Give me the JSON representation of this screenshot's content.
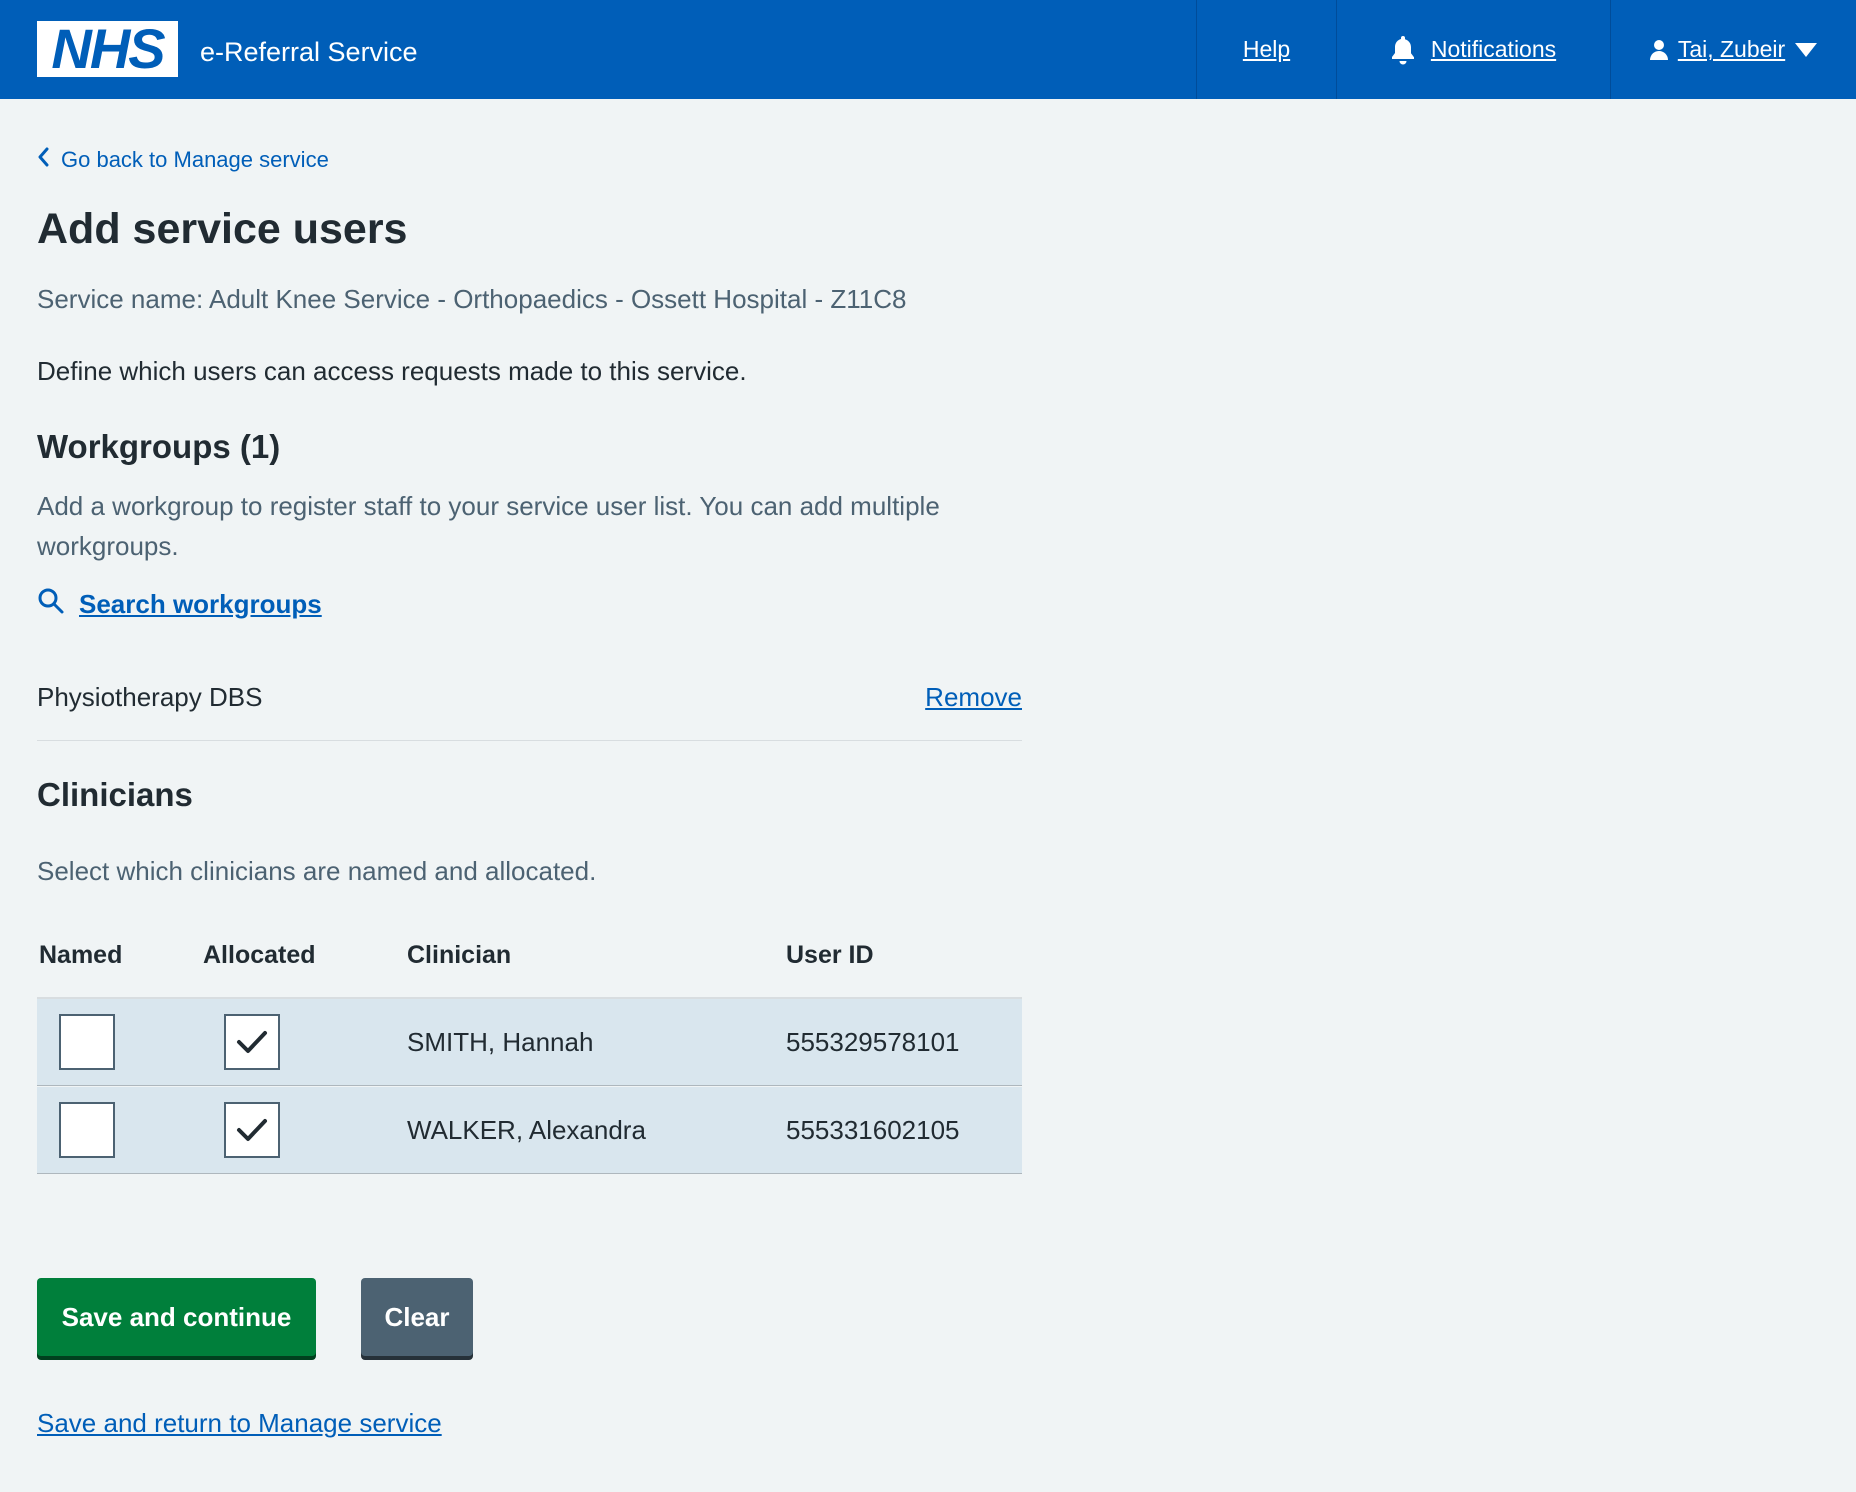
{
  "header": {
    "logo_text": "NHS",
    "service_name": "e-Referral Service",
    "nav": {
      "help": "Help",
      "notifications": "Notifications",
      "user": "Tai, Zubeir"
    }
  },
  "back_link": "Go back to Manage service",
  "page_title": "Add service users",
  "service_line": "Service name: Adult Knee Service - Orthopaedics - Ossett Hospital - Z11C8",
  "intro": "Define which users can access requests made to this service.",
  "workgroups": {
    "heading": "Workgroups (1)",
    "description": "Add a workgroup to register staff to your service user list. You can add multiple workgroups.",
    "search_link": "Search workgroups",
    "items": [
      {
        "name": "Physiotherapy DBS",
        "remove_label": "Remove"
      }
    ]
  },
  "clinicians": {
    "heading": "Clinicians",
    "description": "Select which clinicians are named and allocated.",
    "columns": [
      "Named",
      "Allocated",
      "Clinician",
      "User ID"
    ],
    "rows": [
      {
        "named": false,
        "allocated": true,
        "clinician": "SMITH, Hannah",
        "user_id": "555329578101"
      },
      {
        "named": false,
        "allocated": true,
        "clinician": "WALKER, Alexandra",
        "user_id": "555331602105"
      }
    ]
  },
  "actions": {
    "save_continue": "Save and continue",
    "clear": "Clear",
    "save_return": "Save and return to Manage service"
  },
  "colors": {
    "header_blue": "#005eb8",
    "button_green": "#007f3b",
    "button_grey": "#4c6272",
    "page_bg": "#f0f4f5",
    "row_bg": "#d9e6ee"
  }
}
